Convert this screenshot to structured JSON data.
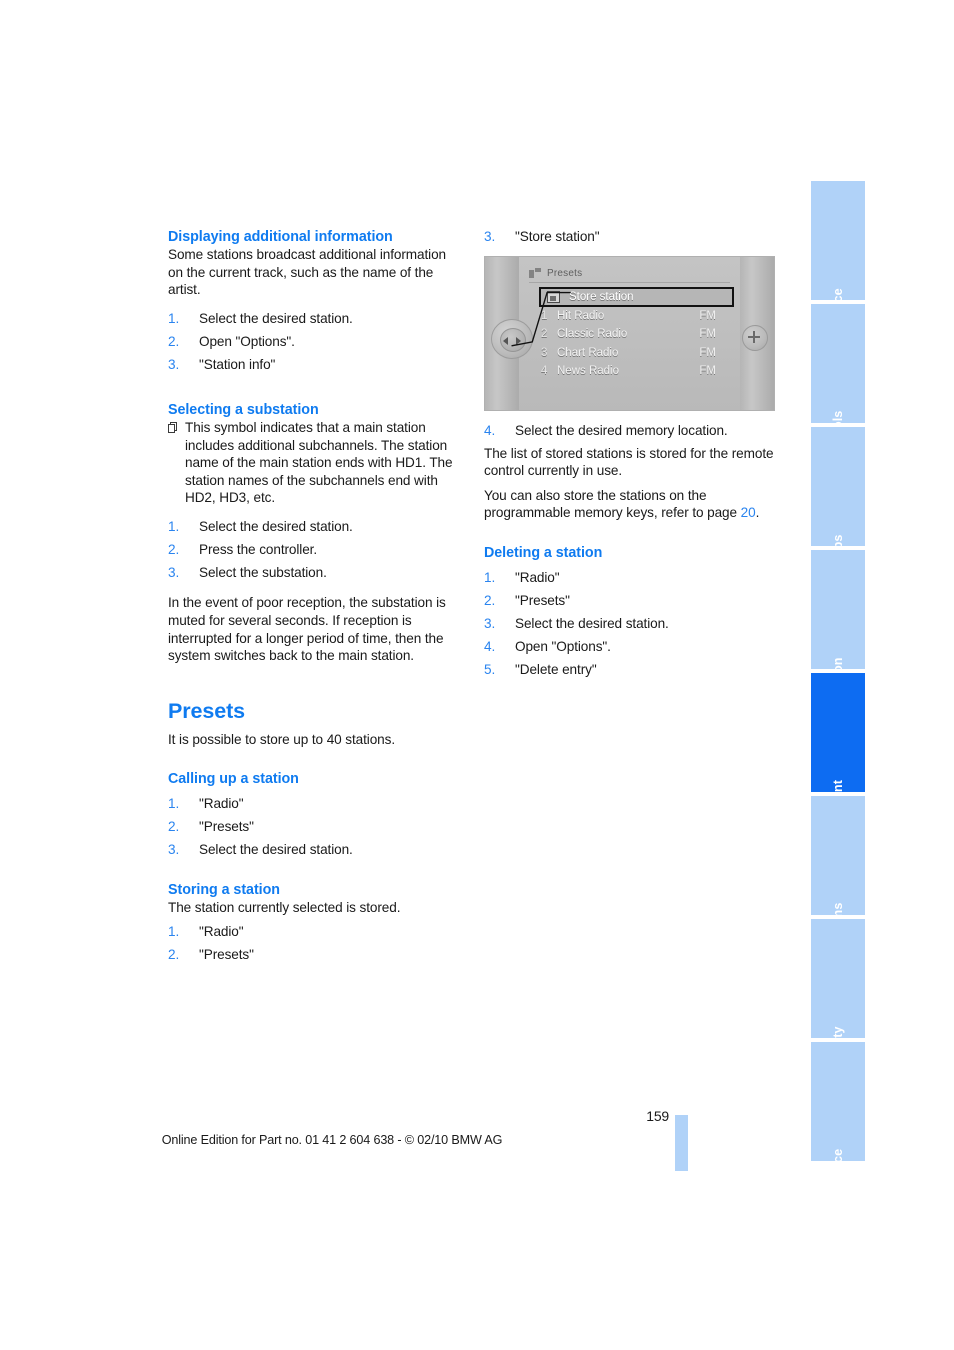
{
  "left_column": {
    "sections": [
      {
        "id": "displaying-additional-information",
        "heading": "Displaying additional information",
        "intro": "Some stations broadcast additional information on the current track, such as the name of the artist.",
        "steps": [
          {
            "num": "1.",
            "text": "Select the desired station."
          },
          {
            "num": "2.",
            "text": "Open \"Options\"."
          },
          {
            "num": "3.",
            "text": "\"Station info\""
          }
        ]
      },
      {
        "id": "selecting-a-substation",
        "heading": "Selecting a substation",
        "symbol_paragraph": "This symbol indicates that a main station includes additional subchannels. The station name of the main station ends with HD1. The station names of the subchannels end with HD2, HD3, etc.",
        "steps": [
          {
            "num": "1.",
            "text": "Select the desired station."
          },
          {
            "num": "2.",
            "text": "Press the controller."
          },
          {
            "num": "3.",
            "text": "Select the substation."
          }
        ],
        "outro": "In the event of poor reception, the substation is muted for several seconds. If reception is interrupted for a longer period of time, then the system switches back to the main station."
      }
    ],
    "presets": {
      "title": "Presets",
      "intro": "It is possible to store up to 40 stations.",
      "calling_up": {
        "heading": "Calling up a station",
        "steps": [
          {
            "num": "1.",
            "text": "\"Radio\""
          },
          {
            "num": "2.",
            "text": "\"Presets\""
          },
          {
            "num": "3.",
            "text": "Select the desired station."
          }
        ]
      },
      "storing": {
        "heading": "Storing a station",
        "intro": "The station currently selected is stored.",
        "steps": [
          {
            "num": "1.",
            "text": "\"Radio\""
          },
          {
            "num": "2.",
            "text": "\"Presets\""
          }
        ]
      }
    }
  },
  "right_column": {
    "continued_step": {
      "num": "3.",
      "text": "\"Store station\""
    },
    "idrive": {
      "header_title": "Presets",
      "selected_entry": "Store station",
      "rows": [
        {
          "index": "1",
          "label": "Hit Radio",
          "band": "FM"
        },
        {
          "index": "2",
          "label": "Classic Radio",
          "band": "FM"
        },
        {
          "index": "3",
          "label": "Chart Radio",
          "band": "FM"
        },
        {
          "index": "4",
          "label": "News Radio",
          "band": "FM"
        }
      ]
    },
    "step_four": {
      "num": "4.",
      "text": "Select the desired memory location."
    },
    "note_one": "The list of stored stations is stored for the remote control currently in use.",
    "note_two_before": "You can also store the stations on the programmable memory keys, refer to page ",
    "note_two_pageref": "20",
    "note_two_after": ".",
    "deleting": {
      "heading": "Deleting a station",
      "steps": [
        {
          "num": "1.",
          "text": "\"Radio\""
        },
        {
          "num": "2.",
          "text": "\"Presets\""
        },
        {
          "num": "3.",
          "text": "Select the desired station."
        },
        {
          "num": "4.",
          "text": "Open \"Options\"."
        },
        {
          "num": "5.",
          "text": "\"Delete entry\""
        }
      ]
    }
  },
  "tabs": [
    {
      "label": "At a glance",
      "active": false
    },
    {
      "label": "Controls",
      "active": false
    },
    {
      "label": "Driving tips",
      "active": false
    },
    {
      "label": "Navigation",
      "active": false
    },
    {
      "label": "Entertainment",
      "active": true
    },
    {
      "label": "Communications",
      "active": false
    },
    {
      "label": "Mobility",
      "active": false
    },
    {
      "label": "Reference",
      "active": false
    }
  ],
  "footer": {
    "page_number": "159",
    "imprint": "Online Edition for Part no. 01 41 2 604 638 - © 02/10 BMW AG"
  },
  "colors": {
    "heading_blue": "#0f7bf0",
    "number_blue": "#2a84ef",
    "tab_inactive": "#b0d2f8",
    "tab_active": "#0d6cf2",
    "text": "#1a1a1a"
  }
}
